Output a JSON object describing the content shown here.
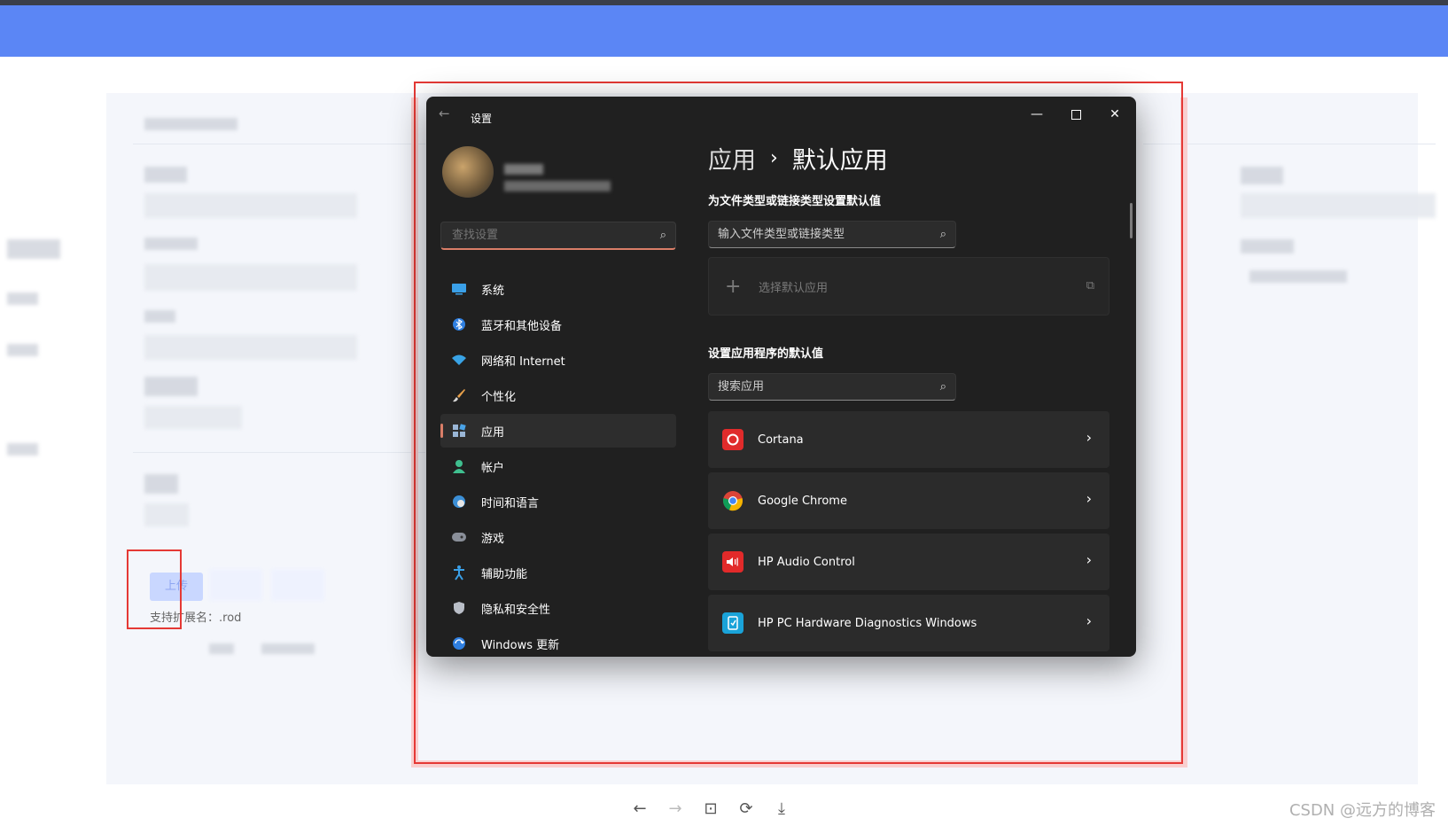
{
  "window": {
    "title": "设置",
    "back_icon": "←",
    "minimize_icon": "—",
    "close_icon": "✕"
  },
  "sidebar": {
    "search_placeholder": "查找设置",
    "search_icon": "⌕",
    "items": [
      {
        "label": "系统",
        "icon": "monitor-icon"
      },
      {
        "label": "蓝牙和其他设备",
        "icon": "bluetooth-icon"
      },
      {
        "label": "网络和 Internet",
        "icon": "wifi-icon"
      },
      {
        "label": "个性化",
        "icon": "brush-icon"
      },
      {
        "label": "应用",
        "icon": "apps-icon"
      },
      {
        "label": "帐户",
        "icon": "person-icon"
      },
      {
        "label": "时间和语言",
        "icon": "globe-clock-icon"
      },
      {
        "label": "游戏",
        "icon": "gamepad-icon"
      },
      {
        "label": "辅助功能",
        "icon": "accessibility-icon"
      },
      {
        "label": "隐私和安全性",
        "icon": "shield-icon"
      },
      {
        "label": "Windows 更新",
        "icon": "update-icon"
      }
    ],
    "active_index": 4
  },
  "content": {
    "breadcrumb_parent": "应用",
    "breadcrumb_separator": "›",
    "breadcrumb_current": "默认应用",
    "filetype_section_title": "为文件类型或链接类型设置默认值",
    "filetype_search_placeholder": "输入文件类型或链接类型",
    "choose_default_label": "选择默认应用",
    "plus_icon": "+",
    "external_link_icon": "⧉",
    "apps_section_title": "设置应用程序的默认值",
    "apps_search_placeholder": "搜索应用",
    "chevron_icon": "›",
    "apps": [
      {
        "name": "Cortana",
        "icon": "cortana-icon",
        "color": "#e02b2b"
      },
      {
        "name": "Google Chrome",
        "icon": "chrome-icon",
        "color": "#4285f4"
      },
      {
        "name": "HP Audio Control",
        "icon": "hp-audio-icon",
        "color": "#e22a2a"
      },
      {
        "name": "HP PC Hardware Diagnostics Windows",
        "icon": "hp-diagnostics-icon",
        "color": "#1aa3d9"
      }
    ]
  },
  "background_page": {
    "upload_label": "上传",
    "support_text": "支持扩展名：.rod"
  },
  "bottom_toolbar": {
    "back": "←",
    "forward": "→",
    "fit": "⊡",
    "rotate": "⟳",
    "download": "⤓"
  },
  "watermark": "CSDN @远方的博客",
  "colors": {
    "header_blue": "#5b86f5",
    "window_bg": "#202020",
    "accent": "#d97e68",
    "annotation_red": "#e53935"
  }
}
